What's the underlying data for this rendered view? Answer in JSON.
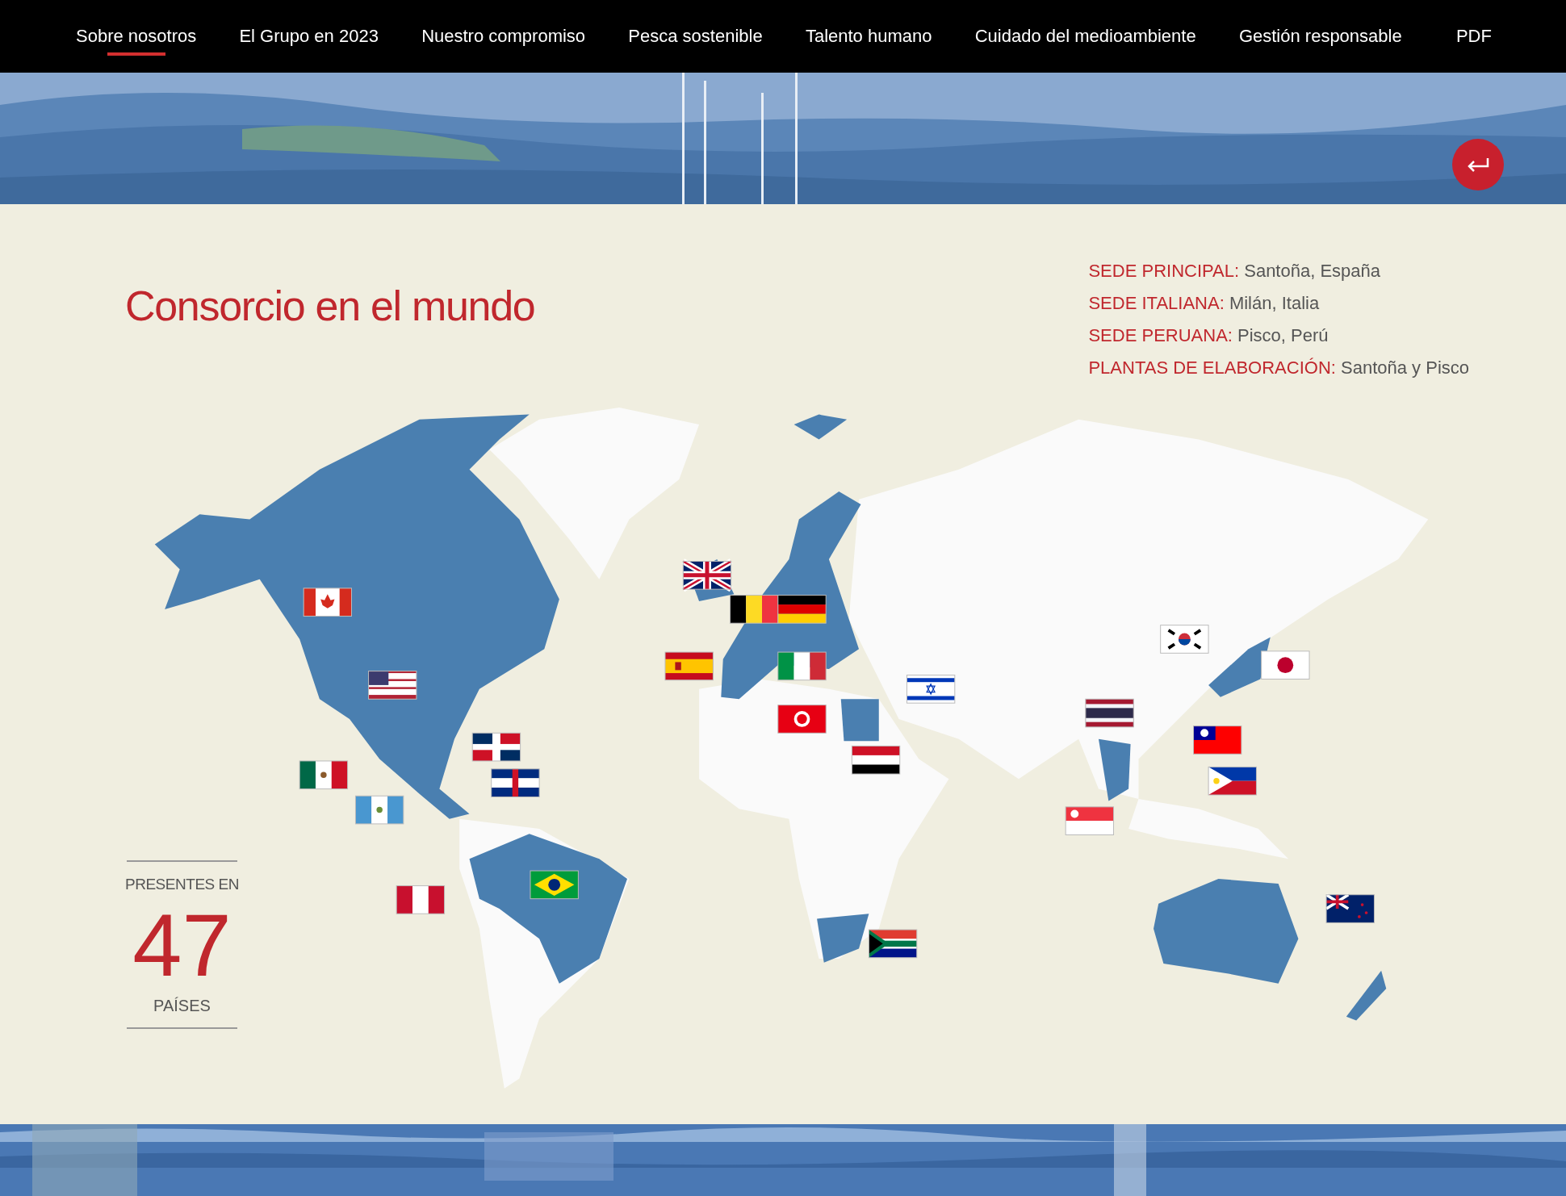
{
  "nav": {
    "items": [
      {
        "label": "Sobre nosotros",
        "selected": true
      },
      {
        "label": "El Grupo en 2023",
        "selected": false
      },
      {
        "label": "Nuestro compromiso",
        "selected": false
      },
      {
        "label": "Pesca sostenible",
        "selected": false
      },
      {
        "label": "Talento humano",
        "selected": false
      },
      {
        "label": "Cuidado del medioambiente",
        "selected": false
      },
      {
        "label": "Gestión responsable",
        "selected": false
      },
      {
        "label": "PDF",
        "selected": false
      }
    ]
  },
  "section": {
    "title": "Consorcio en el mundo",
    "facts": [
      {
        "label": "SEDE PRINCIPAL:",
        "value": "Santoña, España"
      },
      {
        "label": "SEDE ITALIANA:",
        "value": "Milán, Italia"
      },
      {
        "label": "SEDE PERUANA:",
        "value": "Pisco, Perú"
      },
      {
        "label": "PLANTAS DE ELABORACIÓN:",
        "value": "Santoña y Pisco"
      }
    ],
    "counter": {
      "caption_top": "PRESENTES EN",
      "number": "47",
      "caption_bottom": "PAÍSES"
    }
  }
}
